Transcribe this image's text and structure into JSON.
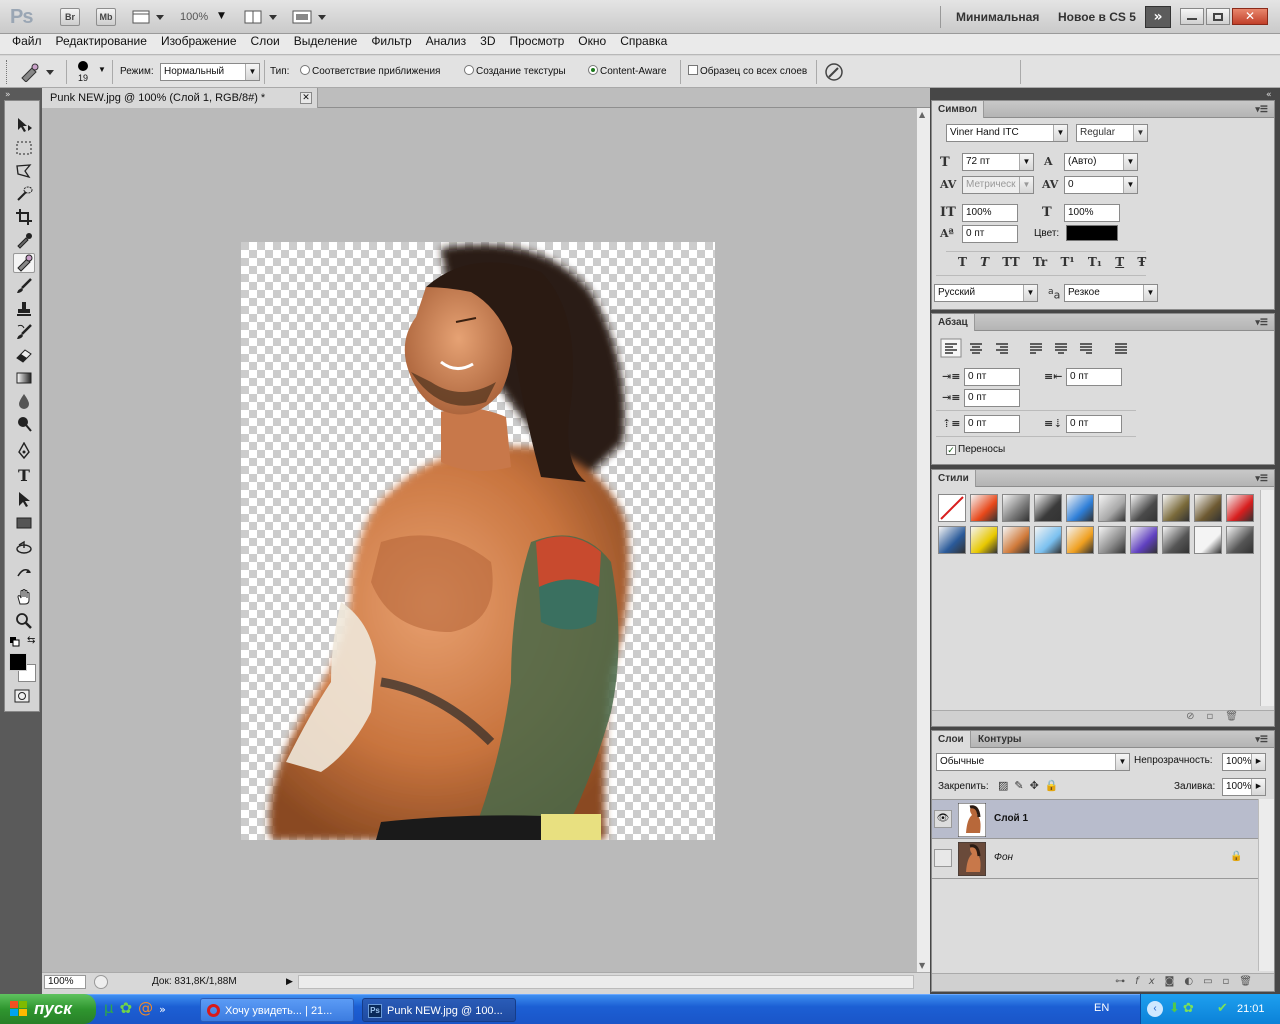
{
  "app": {
    "logo": "Ps",
    "br_label": "Br",
    "mb_label": "Mb",
    "zoom_label": "100%",
    "workspaces": [
      "Минимальная",
      "Новое в CS 5"
    ]
  },
  "menu": [
    "Файл",
    "Редактирование",
    "Изображение",
    "Слои",
    "Выделение",
    "Фильтр",
    "Анализ",
    "3D",
    "Просмотр",
    "Окно",
    "Справка"
  ],
  "options": {
    "brush_size": "19",
    "mode_label": "Режим:",
    "mode_value": "Нормальный",
    "type_label": "Тип:",
    "type_options": [
      "Соответствие приближения",
      "Создание текстуры",
      "Content-Aware"
    ],
    "selected_type": "Content-Aware",
    "sample_all_label": "Образец со всех слоев"
  },
  "document": {
    "tab_title": "Punk NEW.jpg @ 100% (Слой 1, RGB/8#) *",
    "zoom": "100%",
    "doc_info": "Док: 831,8K/1,88M"
  },
  "character": {
    "title": "Символ",
    "font_family": "Viner Hand ITC",
    "font_style": "Regular",
    "font_size": "72 пт",
    "leading": "(Авто)",
    "kerning": "Метрическ",
    "tracking": "0",
    "vscale": "100%",
    "hscale": "100%",
    "baseline": "0 пт",
    "color_label": "Цвет:",
    "color": "#000000",
    "language": "Русский",
    "aa_label": "a",
    "antialias": "Резкое",
    "style_buttons": [
      "T",
      "T",
      "TT",
      "Tr",
      "T¹",
      "T₁",
      "T",
      "Ŧ"
    ]
  },
  "paragraph": {
    "title": "Абзац",
    "indent_left": "0 пт",
    "indent_right": "0 пт",
    "indent_first": "0 пт",
    "space_before": "0 пт",
    "space_after": "0 пт",
    "hyphenate_label": "Переносы",
    "hyphenate": true
  },
  "styles": {
    "title": "Стили",
    "swatches": [
      "#ffffff",
      "#e8481a",
      "#7a7a7a",
      "#3a3a3a",
      "#2f7fd8",
      "#a8a8a8",
      "#4a4a4a",
      "#7a6a3a",
      "#6e5a32",
      "#d81e1e",
      "#2a5a9a",
      "#e8c800",
      "#d07a3a",
      "#7ac0f0",
      "#f0a020",
      "#8a8a8a",
      "#6040c0",
      "#555555",
      "#f4f4f4",
      "#555555"
    ]
  },
  "layers": {
    "tabs": [
      "Слои",
      "Контуры"
    ],
    "blend_mode": "Обычные",
    "opacity_label": "Непрозрачность:",
    "opacity": "100%",
    "lock_label": "Закрепить:",
    "fill_label": "Заливка:",
    "fill": "100%",
    "items": [
      {
        "name": "Слой 1",
        "visible": true,
        "selected": true
      },
      {
        "name": "Фон",
        "visible": false,
        "locked": true
      }
    ]
  },
  "taskbar": {
    "start": "пуск",
    "tasks": [
      "Хочу увидеть... | 21...",
      "Punk NEW.jpg @ 100..."
    ],
    "lang": "EN",
    "time": "21:01"
  }
}
